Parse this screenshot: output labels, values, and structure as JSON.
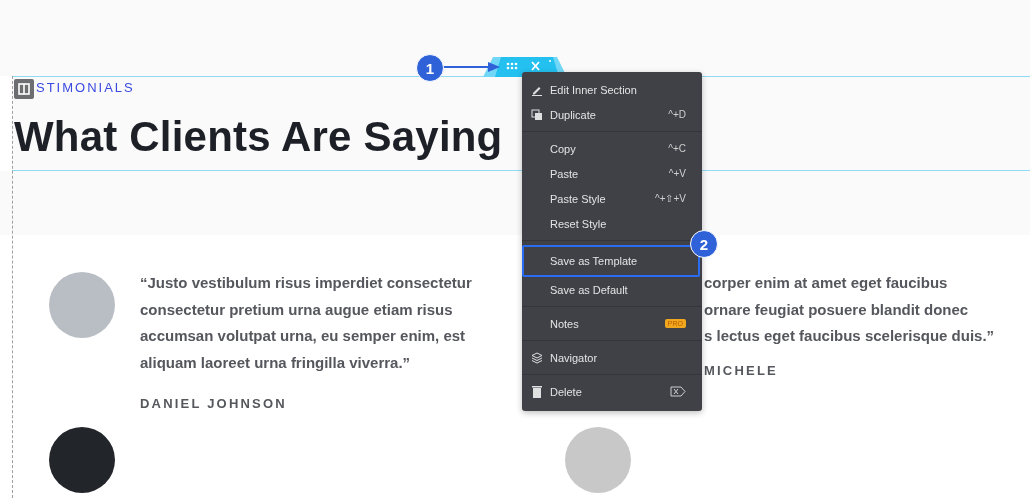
{
  "section": {
    "eyebrow": "STIMONIALS",
    "heading": "What Clients Are Saying"
  },
  "context_menu": {
    "groups": [
      {
        "items": [
          {
            "kind": "edit",
            "label": "Edit Inner Section",
            "selected": false
          },
          {
            "kind": "duplicate",
            "label": "Duplicate",
            "shortcut": "^+D",
            "selected": false
          }
        ]
      },
      {
        "items": [
          {
            "kind": "plain",
            "label": "Copy",
            "shortcut": "^+C",
            "selected": false
          },
          {
            "kind": "plain",
            "label": "Paste",
            "shortcut": "^+V",
            "selected": false
          },
          {
            "kind": "plain",
            "label": "Paste Style",
            "shortcut": "^+⇧+V",
            "selected": false
          },
          {
            "kind": "plain",
            "label": "Reset Style",
            "selected": false
          }
        ]
      },
      {
        "items": [
          {
            "kind": "plain",
            "label": "Save as Template",
            "selected": true
          },
          {
            "kind": "plain",
            "label": "Save as Default",
            "selected": false
          }
        ]
      },
      {
        "items": [
          {
            "kind": "plain",
            "label": "Notes",
            "badge": "PRO",
            "selected": false
          }
        ]
      },
      {
        "items": [
          {
            "kind": "navigator",
            "label": "Navigator",
            "selected": false
          }
        ]
      },
      {
        "items": [
          {
            "kind": "delete",
            "label": "Delete",
            "selected": false
          }
        ]
      }
    ]
  },
  "callouts": [
    {
      "number": "1"
    },
    {
      "number": "2"
    }
  ],
  "testimonials": [
    {
      "kind": "full",
      "lines": [
        "“Justo vestibulum risus imperdiet consectetur",
        "consectetur pretium urna augue etiam risus",
        "accumsan volutpat urna, eu semper enim, est",
        "aliquam laoreet urna fringilla viverra.”"
      ],
      "name": "DANIEL JOHNSON"
    },
    {
      "kind": "covered",
      "lines": [
        "corper enim at amet eget faucibus",
        "ornare feugiat posuere blandit donec",
        "s lectus eget faucibus scelerisque duis.”"
      ],
      "name": "MICHELE"
    }
  ]
}
